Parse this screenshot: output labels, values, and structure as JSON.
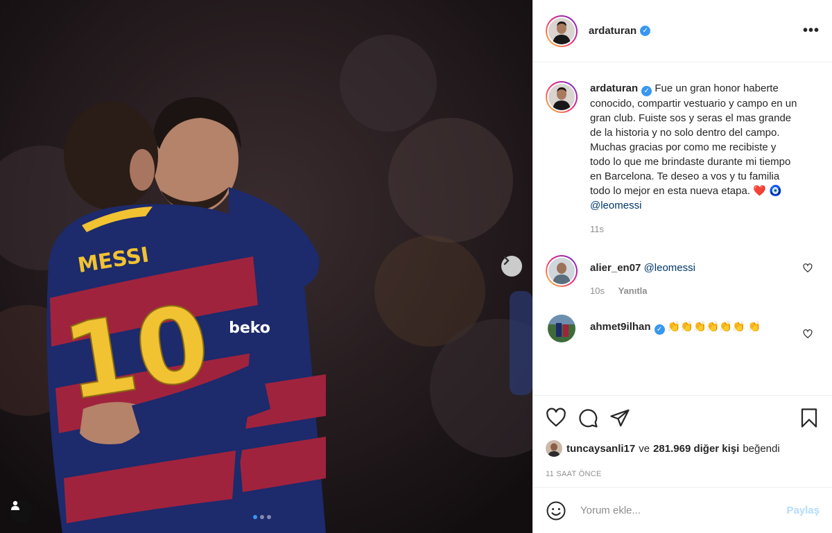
{
  "post": {
    "username": "ardaturan",
    "more_label": "•••",
    "caption_part1": "Fue un gran honor haberte conocido, compartir vestuario y campo en un gran club. Fuiste sos y seras el mas grande de la historia y no solo dentro del campo.",
    "caption_part2": "Muchas gracias por como me recibiste y todo lo que me brindaste durante mi tiempo en Barcelona. Te deseo a vos y tu familia todo lo mejor en esta nueva etapa.",
    "caption_emojis": "❤️ 🧿",
    "caption_mention": "@leomessi",
    "caption_time": "11s"
  },
  "jersey": {
    "name": "MESSI",
    "number": "10",
    "sponsor": "beko"
  },
  "comments": [
    {
      "username": "alier_en07",
      "mention": "@leomessi",
      "time": "10s",
      "reply_label": "Yanıtla"
    },
    {
      "username": "ahmet9ilhan",
      "emojis": "👏👏👏👏👏👏 👏"
    }
  ],
  "likes": {
    "user": "tuncaysanli17",
    "connector": "ve",
    "others": "281.969 diğer kişi",
    "suffix": "beğendi"
  },
  "time_ago": "11 SAAT ÖNCE",
  "add_comment": {
    "placeholder": "Yorum ekle...",
    "share_label": "Paylaş"
  },
  "carousel": {
    "count": 3,
    "active_index": 0
  },
  "colors": {
    "verified": "#3897f0",
    "share_disabled": "#b3dbff",
    "mention": "#00376b",
    "jersey_blue": "#1d2a6b",
    "jersey_red": "#a0233d",
    "jersey_gold": "#f1c232"
  },
  "icons": [
    "chevron-right-icon",
    "tag-user-icon",
    "heart-icon",
    "comment-icon",
    "share-icon",
    "bookmark-icon",
    "emoji-icon"
  ]
}
